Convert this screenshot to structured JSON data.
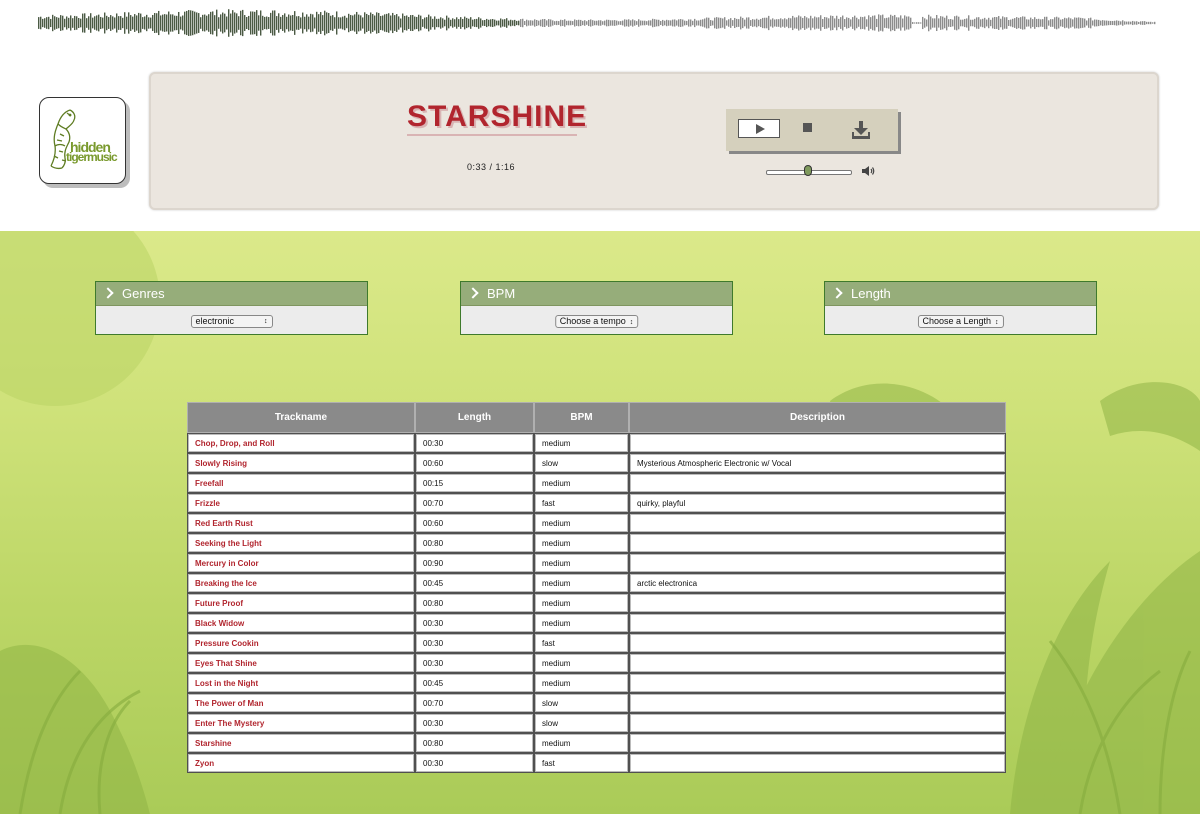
{
  "player": {
    "track_title": "STARSHINE",
    "time_display": "0:33 / 1:16",
    "progress_fraction": 0.43,
    "volume_fraction": 0.5,
    "play_icon": "play-icon",
    "stop_icon": "stop-icon",
    "download_icon": "download-icon",
    "speaker_icon": "speaker-icon"
  },
  "logo": {
    "line1": "hidden",
    "line2": "tigermusic"
  },
  "filters": [
    {
      "label": "Genres",
      "selected": "electronic"
    },
    {
      "label": "BPM",
      "selected": "Choose a tempo"
    },
    {
      "label": "Length",
      "selected": "Choose a Length"
    }
  ],
  "table": {
    "headers": [
      "Trackname",
      "Length",
      "BPM",
      "Description"
    ],
    "rows": [
      [
        "Chop, Drop, and Roll",
        "00:30",
        "medium",
        ""
      ],
      [
        "Slowly Rising",
        "00:60",
        "slow",
        "Mysterious Atmospheric Electronic w/ Vocal"
      ],
      [
        "Freefall",
        "00:15",
        "medium",
        ""
      ],
      [
        "Frizzle",
        "00:70",
        "fast",
        "quirky, playful"
      ],
      [
        "Red Earth Rust",
        "00:60",
        "medium",
        ""
      ],
      [
        "Seeking the Light",
        "00:80",
        "medium",
        ""
      ],
      [
        "Mercury in Color",
        "00:90",
        "medium",
        ""
      ],
      [
        "Breaking the Ice",
        "00:45",
        "medium",
        "arctic electronica"
      ],
      [
        "Future Proof",
        "00:80",
        "medium",
        ""
      ],
      [
        "Black Widow",
        "00:30",
        "medium",
        ""
      ],
      [
        "Pressure Cookin",
        "00:30",
        "fast",
        ""
      ],
      [
        "Eyes That Shine",
        "00:30",
        "medium",
        ""
      ],
      [
        "Lost in the Night",
        "00:45",
        "medium",
        ""
      ],
      [
        "The Power of Man",
        "00:70",
        "slow",
        ""
      ],
      [
        "Enter The Mystery",
        "00:30",
        "slow",
        ""
      ],
      [
        "Starshine",
        "00:80",
        "medium",
        ""
      ],
      [
        "Zyon",
        "00:30",
        "fast",
        ""
      ]
    ]
  },
  "colors": {
    "accent_red": "#b1252e",
    "waveform_played": "#4b5a44",
    "waveform_unplayed": "#8c8c8c",
    "filter_header": "#96ad7a"
  }
}
